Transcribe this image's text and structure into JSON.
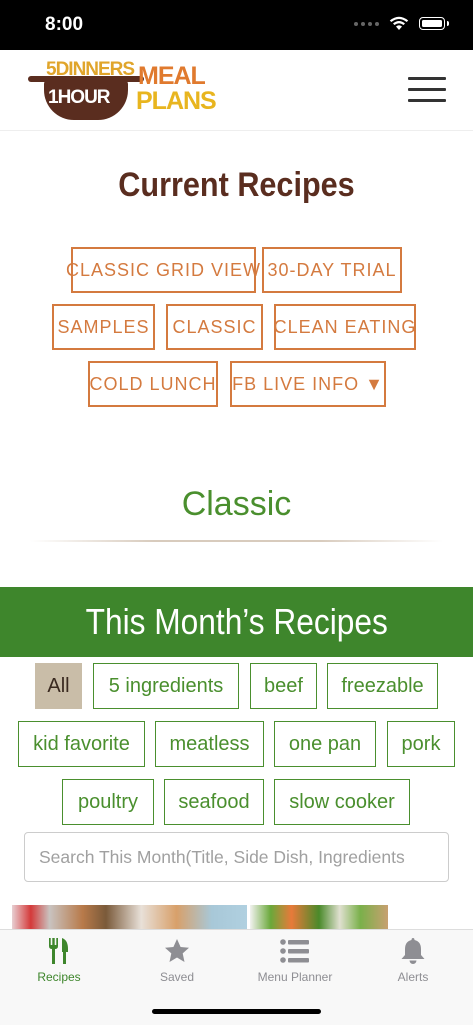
{
  "status": {
    "time": "8:00"
  },
  "logo": {
    "line1": "5DINNERS",
    "line2": "1HOUR",
    "meal": "MEAL",
    "plans": "PLANS"
  },
  "page_title": "Current Recipes",
  "menu_buttons": [
    "CLASSIC GRID VIEW",
    "30-DAY TRIAL",
    "SAMPLES",
    "CLASSIC",
    "CLEAN EATING",
    "COLD LUNCH",
    "FB LIVE INFO ▼"
  ],
  "section_heading": "Classic",
  "banner": "This Month’s Recipes",
  "filters": [
    "All",
    "5 ingredients",
    "beef",
    "freezable",
    "kid favorite",
    "meatless",
    "one pan",
    "pork",
    "poultry",
    "seafood",
    "slow cooker"
  ],
  "active_filter": "All",
  "search": {
    "placeholder": "Search This Month(Title, Side Dish, Ingredients"
  },
  "tabs": [
    {
      "label": "Recipes",
      "icon": "fork-knife-icon",
      "active": true
    },
    {
      "label": "Saved",
      "icon": "star-icon",
      "active": false
    },
    {
      "label": "Menu Planner",
      "icon": "list-icon",
      "active": false
    },
    {
      "label": "Alerts",
      "icon": "bell-icon",
      "active": false
    }
  ],
  "colors": {
    "brand_green": "#3e862c",
    "brand_orange": "#d47a3f",
    "brand_brown": "#5a2d1f",
    "active_chip": "#c9bda8"
  }
}
